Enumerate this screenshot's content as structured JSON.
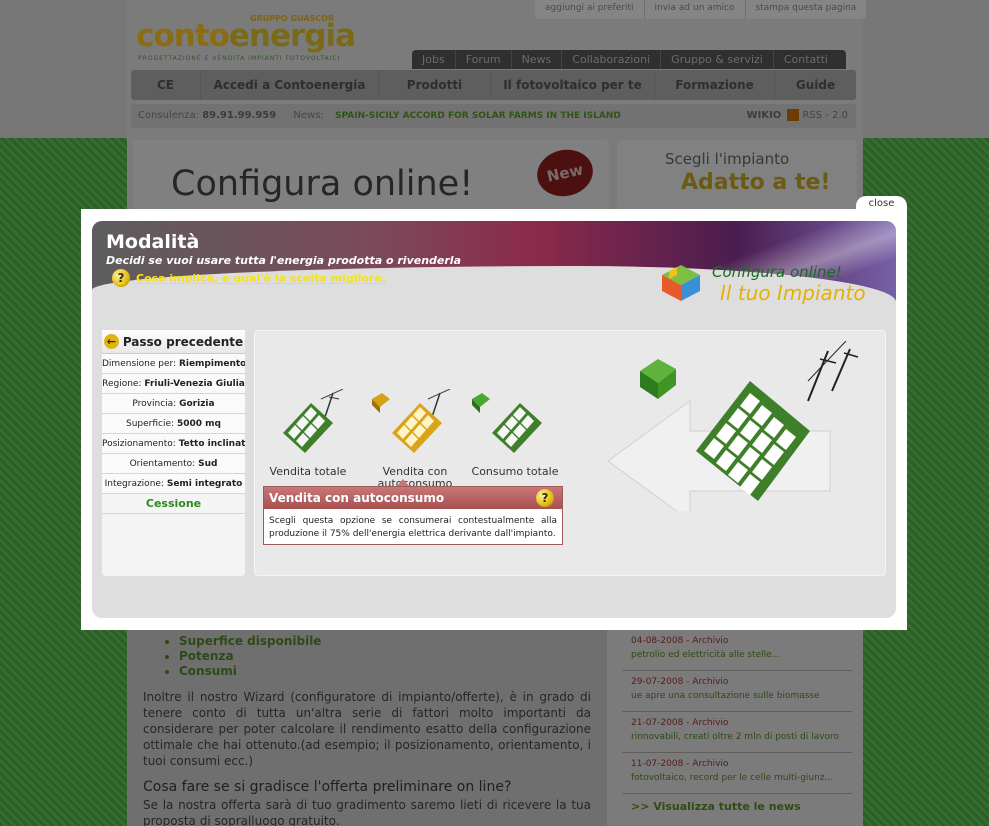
{
  "background": {
    "logo": {
      "part1": "conto",
      "part2": "energia",
      "group": "GRUPPO GUASCOR",
      "tagline": "PROGETTAZIONE E VENDITA IMPIANTI FOTOVOLTAICI"
    },
    "utility_links": [
      "aggiungi ai preferiti",
      "invia ad un amico",
      "stampa questa pagina"
    ],
    "top_nav": [
      "Jobs",
      "Forum",
      "News",
      "Collaborazioni",
      "Gruppo & servizi",
      "Contatti"
    ],
    "main_nav": [
      "CE",
      "Accedi a Contoenergia",
      "Prodotti",
      "Il fotovoltaico per te",
      "Formazione",
      "Guide"
    ],
    "ticker": {
      "consulenza_label": "Consulenza:",
      "phone": "89.91.99.959",
      "news_label": "News:",
      "news_text": "SPAIN-SICILY ACCORD FOR SOLAR FARMS IN THE ISLAND",
      "wikio": "WIKIO",
      "rss": "RSS - 2.0"
    },
    "banner": {
      "title": "Configura online!",
      "badge": "New"
    },
    "side_banner": {
      "line1": "Scegli l'impianto",
      "line2": "Adatto a te!"
    },
    "content": {
      "bullets": [
        "Superfice disponibile",
        "Potenza",
        "Consumi"
      ],
      "paragraph1": "Inoltre il nostro Wizard (configuratore di impianto/offerte), è in grado di tenere conto di tutta un'altra serie di fattori molto importanti da considerare per poter calcolare il rendimento esatto della configurazione ottimale che hai ottenuto.(ad esempio; il posizionamento, orientamento, i tuoi consumi ecc.)",
      "heading": "Cosa fare se si gradisce l'offerta preliminare on line?",
      "paragraph2": "Se la nostra offerta sarà di tuo gradimento saremo lieti di ricevere la tua proposta di sopralluogo gratuito."
    },
    "news": [
      {
        "date": "04-08-2008",
        "tag": "Archivio",
        "text": "petrolio ed elettricità alle stelle..."
      },
      {
        "date": "29-07-2008",
        "tag": "Archivio",
        "text": "ue apre una consultazione sulle biomasse"
      },
      {
        "date": "21-07-2008",
        "tag": "Archivio",
        "text": "rinnovabili, creati oltre 2 mln di posti di lavoro"
      },
      {
        "date": "11-07-2008",
        "tag": "Archivio",
        "text": "fotovoltaico, record per le celle multi-giunz..."
      }
    ],
    "news_view_all": ">> Visualizza tutte le news"
  },
  "modal": {
    "close_label": "close",
    "title": "Modalità",
    "subtitle": "Decidi se vuoi usare tutta l'energia prodotta o rivenderla",
    "help_link": "Cosa implica, e qual'è la scelta migliore.",
    "brand_line1": "Configura online!",
    "brand_line2": "Il tuo Impianto",
    "prev_label": "Passo precedente",
    "steps": [
      {
        "label": "Dimensione per:",
        "value": "Riempimento"
      },
      {
        "label": "Regione:",
        "value": "Friuli-Venezia Giulia"
      },
      {
        "label": "Provincia:",
        "value": "Gorizia"
      },
      {
        "label": "Superficie:",
        "value": "5000 mq"
      },
      {
        "label": "Posizionamento:",
        "value": "Tetto inclinato"
      },
      {
        "label": "Orientamento:",
        "value": "Sud"
      },
      {
        "label": "Integrazione:",
        "value": "Semi integrato"
      }
    ],
    "current_step": "Cessione",
    "options": [
      {
        "label": "Vendita totale"
      },
      {
        "label": "Vendita con",
        "label2": "autoconsumo"
      },
      {
        "label": "Consumo totale"
      }
    ],
    "info": {
      "title": "Vendita con autoconsumo",
      "body": "Scegli questa opzione se consumerai contestualmente alla produzione il 75% dell'energia elettrica derivante dall'impianto."
    }
  }
}
